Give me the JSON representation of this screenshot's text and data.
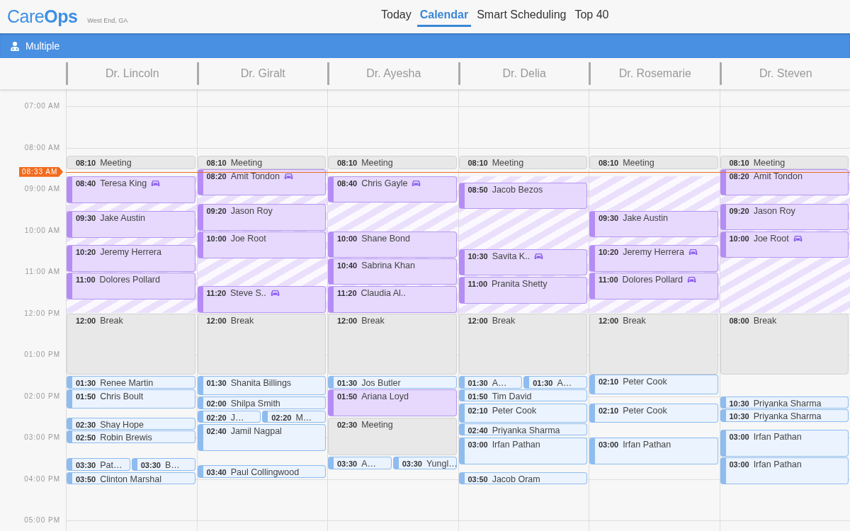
{
  "app": {
    "brand": "Care**Ops**",
    "location": "West End, GA"
  },
  "nav": [
    {
      "label": "Today",
      "selected": false
    },
    {
      "label": "Calendar",
      "selected": true
    },
    {
      "label": "Smart Scheduling",
      "selected": false
    },
    {
      "label": "Top 40",
      "selected": false
    }
  ],
  "toolbar": {
    "label": "Multiple"
  },
  "time_labels": [
    "07:00 AM",
    "08:00 AM",
    "09:00 AM",
    "10:00 AM",
    "11:00 AM",
    "12:00 PM",
    "01:00 PM",
    "02:00 PM",
    "03:00 PM",
    "04:00 PM",
    "05:00 PM"
  ],
  "now": {
    "label": "08:33 AM"
  },
  "columns": [
    {
      "doctor": "Dr. Lincoln",
      "events": [
        {
          "time": "08:10",
          "name": "Meeting",
          "kind": "block",
          "car": false
        },
        {
          "time": "08:40",
          "name": "Teresa King",
          "kind": "visit",
          "car": true
        },
        {
          "time": "09:30",
          "name": "Jake Austin",
          "kind": "visit",
          "car": false
        },
        {
          "time": "10:20",
          "name": "Jeremy Herrera",
          "kind": "visit",
          "car": false
        },
        {
          "time": "11:00",
          "name": "Dolores Pollard",
          "kind": "visit",
          "car": false
        },
        {
          "time": "12:00",
          "name": "Break",
          "kind": "block",
          "car": false
        },
        {
          "time": "01:30",
          "name": "Renee Martin",
          "kind": "office",
          "car": false
        },
        {
          "time": "01:50",
          "name": "Chris Boult",
          "kind": "office",
          "car": false
        },
        {
          "time": "02:30",
          "name": "Shay Hope",
          "kind": "office",
          "car": false
        },
        {
          "time": "02:50",
          "name": "Robin Brewis",
          "kind": "office",
          "car": false
        },
        {
          "time": "03:30",
          "name": "Pat…",
          "kind": "office",
          "car": false
        },
        {
          "time": "03:30",
          "name": "B…",
          "kind": "office",
          "car": false
        },
        {
          "time": "03:50",
          "name": "Clinton Marshal",
          "kind": "office",
          "car": false
        }
      ]
    },
    {
      "doctor": "Dr. Giralt",
      "events": [
        {
          "time": "08:10",
          "name": "Meeting",
          "kind": "block",
          "car": false
        },
        {
          "time": "08:20",
          "name": "Amit Tondon",
          "kind": "visit",
          "car": true
        },
        {
          "time": "09:20",
          "name": "Jason Roy",
          "kind": "visit",
          "car": false
        },
        {
          "time": "10:00",
          "name": "Joe Root",
          "kind": "visit",
          "car": false
        },
        {
          "time": "11:20",
          "name": "Steve S..",
          "kind": "visit",
          "car": true
        },
        {
          "time": "12:00",
          "name": "Break",
          "kind": "block",
          "car": false
        },
        {
          "time": "01:30",
          "name": "Shanita Billings",
          "kind": "office",
          "car": false
        },
        {
          "time": "02:00",
          "name": "Shilpa Smith",
          "kind": "office",
          "car": false
        },
        {
          "time": "02:20",
          "name": "J…",
          "kind": "office",
          "car": false
        },
        {
          "time": "02:20",
          "name": "M…",
          "kind": "office",
          "car": false
        },
        {
          "time": "02:40",
          "name": "Jamil Nagpal",
          "kind": "office",
          "car": false
        },
        {
          "time": "03:40",
          "name": "Paul Collingwood",
          "kind": "office",
          "car": false
        }
      ]
    },
    {
      "doctor": "Dr. Ayesha",
      "events": [
        {
          "time": "08:10",
          "name": "Meeting",
          "kind": "block",
          "car": false
        },
        {
          "time": "08:40",
          "name": "Chris Gayle",
          "kind": "visit",
          "car": true
        },
        {
          "time": "10:00",
          "name": "Shane Bond",
          "kind": "visit",
          "car": false
        },
        {
          "time": "10:40",
          "name": "Sabrina Khan",
          "kind": "visit",
          "car": false
        },
        {
          "time": "11:20",
          "name": "Claudia Al..",
          "kind": "visit",
          "car": false
        },
        {
          "time": "12:00",
          "name": "Break",
          "kind": "block",
          "car": false
        },
        {
          "time": "01:30",
          "name": "Jos Butler",
          "kind": "office",
          "car": false
        },
        {
          "time": "01:50",
          "name": "Ariana Loyd",
          "kind": "visit",
          "car": false
        },
        {
          "time": "02:30",
          "name": "Meeting",
          "kind": "block",
          "car": false
        },
        {
          "time": "03:30",
          "name": "A…",
          "kind": "office",
          "car": false
        },
        {
          "time": "03:30",
          "name": "Yungl…",
          "kind": "office",
          "car": false
        }
      ]
    },
    {
      "doctor": "Dr. Delia",
      "events": [
        {
          "time": "08:10",
          "name": "Meeting",
          "kind": "block",
          "car": false
        },
        {
          "time": "08:50",
          "name": "Jacob Bezos",
          "kind": "visit",
          "car": false
        },
        {
          "time": "10:30",
          "name": "Savita K..",
          "kind": "visit",
          "car": true
        },
        {
          "time": "11:00",
          "name": "Pranita Shetty",
          "kind": "visit",
          "car": false
        },
        {
          "time": "12:00",
          "name": "Break",
          "kind": "block",
          "car": false
        },
        {
          "time": "01:30",
          "name": "A…",
          "kind": "office",
          "car": false
        },
        {
          "time": "01:30",
          "name": "A…",
          "kind": "office",
          "car": false
        },
        {
          "time": "01:50",
          "name": "Tim David",
          "kind": "office",
          "car": false
        },
        {
          "time": "02:10",
          "name": "Peter Cook",
          "kind": "office",
          "car": false
        },
        {
          "time": "02:40",
          "name": "Priyanka Sharma",
          "kind": "office",
          "car": false
        },
        {
          "time": "03:00",
          "name": "Irfan Pathan",
          "kind": "office",
          "car": false
        },
        {
          "time": "03:50",
          "name": "Jacob Oram",
          "kind": "office",
          "car": false
        }
      ]
    },
    {
      "doctor": "Dr. Rosemarie",
      "events": [
        {
          "time": "08:10",
          "name": "Meeting",
          "kind": "block",
          "car": false
        },
        {
          "time": "09:30",
          "name": "Jake Austin",
          "kind": "visit",
          "car": false
        },
        {
          "time": "10:20",
          "name": "Jeremy Herrera",
          "kind": "visit",
          "car": true
        },
        {
          "time": "11:00",
          "name": "Dolores Pollard",
          "kind": "visit",
          "car": true
        },
        {
          "time": "12:00",
          "name": "Break",
          "kind": "block",
          "car": false
        },
        {
          "time": "02:10",
          "name": "Peter Cook",
          "kind": "office",
          "car": false
        },
        {
          "time": "02:10",
          "name": "Peter Cook",
          "kind": "office",
          "car": false
        },
        {
          "time": "03:00",
          "name": "Irfan Pathan",
          "kind": "office",
          "car": false
        }
      ]
    },
    {
      "doctor": "Dr. Steven",
      "events": [
        {
          "time": "08:10",
          "name": "Meeting",
          "kind": "block",
          "car": false
        },
        {
          "time": "08:20",
          "name": "Amit Tondon",
          "kind": "visit",
          "car": false
        },
        {
          "time": "09:20",
          "name": "Jason Roy",
          "kind": "visit",
          "car": false
        },
        {
          "time": "10:00",
          "name": "Joe Root",
          "kind": "visit",
          "car": true
        },
        {
          "time": "08:00",
          "name": "Break",
          "kind": "block",
          "car": false
        },
        {
          "time": "10:30",
          "name": "Priyanka Sharma",
          "kind": "office",
          "car": false
        },
        {
          "time": "10:30",
          "name": "Priyanka Sharma",
          "kind": "office",
          "car": false
        },
        {
          "time": "03:00",
          "name": "Irfan Pathan",
          "kind": "office",
          "car": false
        },
        {
          "time": "03:00",
          "name": "Irfan Pathan",
          "kind": "office",
          "car": false
        }
      ]
    }
  ]
}
